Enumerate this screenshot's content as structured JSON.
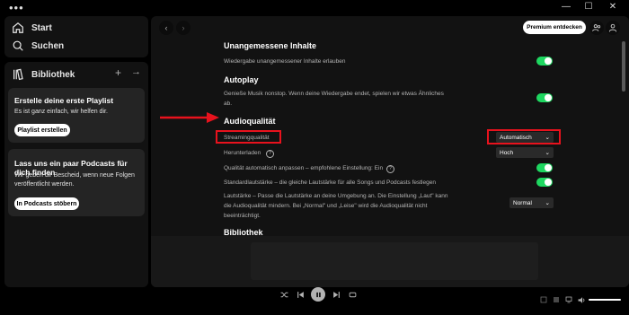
{
  "titlebar": {
    "menu_glyph": "•••",
    "minimize_glyph": "—",
    "maximize_glyph": "☐",
    "close_glyph": "✕"
  },
  "nav": {
    "home_label": "Start",
    "search_label": "Suchen"
  },
  "library": {
    "label": "Bibliothek"
  },
  "playlist_card": {
    "title": "Erstelle deine erste Playlist",
    "text": "Es ist ganz einfach, wir helfen dir.",
    "button": "Playlist erstellen"
  },
  "podcast_card": {
    "title": "Lass uns ein paar Podcasts für dich finden",
    "text_line1": "Wir geben dir Bescheid, wenn neue Folgen",
    "text_line2": "veröffentlicht werden.",
    "button": "In Podcasts stöbern"
  },
  "header": {
    "premium_button": "Premium entdecken"
  },
  "settings": {
    "explicit": {
      "title": "Unangemessene Inhalte",
      "desc": "Wiedergabe unangemessener Inhalte erlauben",
      "enabled": true
    },
    "autoplay": {
      "title": "Autoplay",
      "desc_line1": "Genieße Musik nonstop. Wenn deine Wiedergabe endet, spielen wir etwas Ähnliches",
      "desc_line2": "ab.",
      "enabled": true
    },
    "audio": {
      "title": "Audioqualität",
      "streaming_label": "Streamingqualität",
      "streaming_value": "Automatisch",
      "download_label": "Herunterladen",
      "download_value": "Hoch",
      "auto_adjust_label": "Qualität automatisch anpassen – empfohlene Einstellung: Ein",
      "auto_adjust_enabled": true,
      "normalize_label": "Standardlautstärke – die gleiche Lautstärke für alle Songs und Podcasts festlegen",
      "normalize_enabled": true,
      "level_line1": "Lautstärke – Passe die Lautstärke an deine Umgebung an. Die Einstellung „Laut\" kann",
      "level_line2": "die Audioqualität mindern. Bei „Normal\" und „Leise\" wird die Audioqualität nicht",
      "level_line3": "beeinträchtigt.",
      "level_value": "Normal"
    },
    "library": {
      "title": "Bibliothek"
    }
  },
  "colors": {
    "accent_green": "#1ed760",
    "annotation_red": "#e8121d",
    "panel": "#121212",
    "card": "#242424"
  }
}
